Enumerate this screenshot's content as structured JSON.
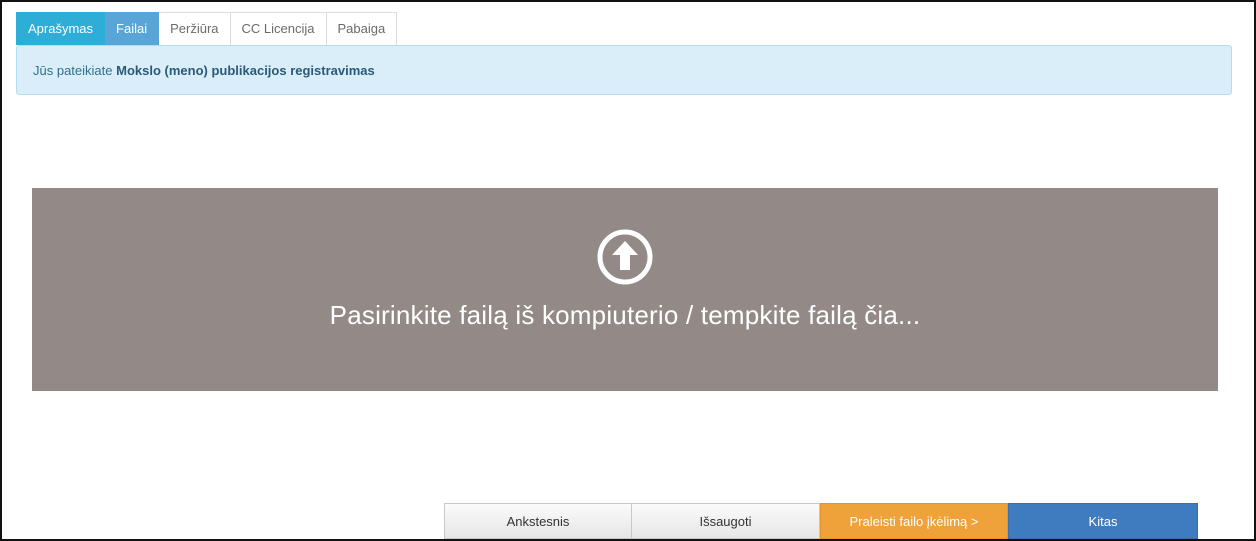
{
  "tabs": [
    {
      "label": "Aprašymas",
      "state": "done"
    },
    {
      "label": "Failai",
      "state": "active"
    },
    {
      "label": "Peržiūra",
      "state": "pending"
    },
    {
      "label": "CC Licencija",
      "state": "pending"
    },
    {
      "label": "Pabaiga",
      "state": "pending"
    }
  ],
  "info": {
    "prefix": "Jūs pateikiate",
    "strong": "Mokslo (meno) publikacijos registravimas"
  },
  "dropzone": {
    "icon": "arrow-up-circle-icon",
    "text": "Pasirinkite failą iš kompiuterio / tempkite failą čia..."
  },
  "buttons": {
    "previous": "Ankstesnis",
    "save": "Išsaugoti",
    "skip": "Praleisti failo įkėlimą >",
    "next": "Kitas"
  },
  "colors": {
    "tab_done": "#2eaed6",
    "tab_active": "#5aa5d8",
    "dropzone_bg": "#938a87",
    "skip_button": "#f0a23a",
    "next_button": "#3f7bbf"
  }
}
